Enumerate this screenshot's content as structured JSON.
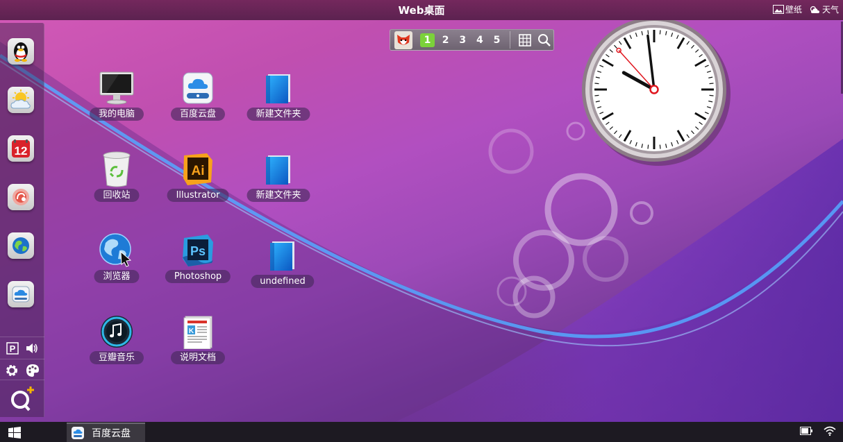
{
  "topbar": {
    "title": "Web桌面",
    "wallpaper_label": "壁纸",
    "weather_label": "天气"
  },
  "dock": {
    "apps": [
      {
        "name": "qq-penguin-icon"
      },
      {
        "name": "weather-sun-cloud-icon"
      },
      {
        "name": "calendar-icon",
        "text": "12"
      },
      {
        "name": "music-player-icon"
      },
      {
        "name": "browser-globe-icon"
      },
      {
        "name": "cloud-drive-icon"
      }
    ]
  },
  "pager": {
    "pages": [
      "1",
      "2",
      "3",
      "4",
      "5"
    ],
    "active_page": "1"
  },
  "desktop": {
    "icons": [
      {
        "label": "我的电脑",
        "icon": "computer-monitor-icon"
      },
      {
        "label": "百度云盘",
        "icon": "baidu-cloud-icon"
      },
      {
        "label": "新建文件夹",
        "icon": "blue-folder-icon"
      },
      {
        "label": "回收站",
        "icon": "recycle-bin-icon"
      },
      {
        "label": "Illustrator",
        "icon": "illustrator-icon",
        "text": "Ai"
      },
      {
        "label": "新建文件夹",
        "icon": "blue-folder-icon"
      },
      {
        "label": "浏览器",
        "icon": "browser-globe-icon"
      },
      {
        "label": "Photoshop",
        "icon": "photoshop-icon",
        "text": "Ps"
      },
      {
        "label": "undefined",
        "icon": "blue-folder-icon"
      },
      {
        "label": "豆瓣音乐",
        "icon": "music-note-icon"
      },
      {
        "label": "说明文档",
        "icon": "document-icon",
        "text": "K"
      }
    ]
  },
  "clock": {
    "hour": 9,
    "minute": 58,
    "second": 53
  },
  "taskbar": {
    "task_label": "百度云盘"
  },
  "colors": {
    "topbar": "#74285d",
    "taskbar": "#1d1a22",
    "pager_active": "#7bd23a",
    "clock_second_hand": "#e0161e"
  }
}
